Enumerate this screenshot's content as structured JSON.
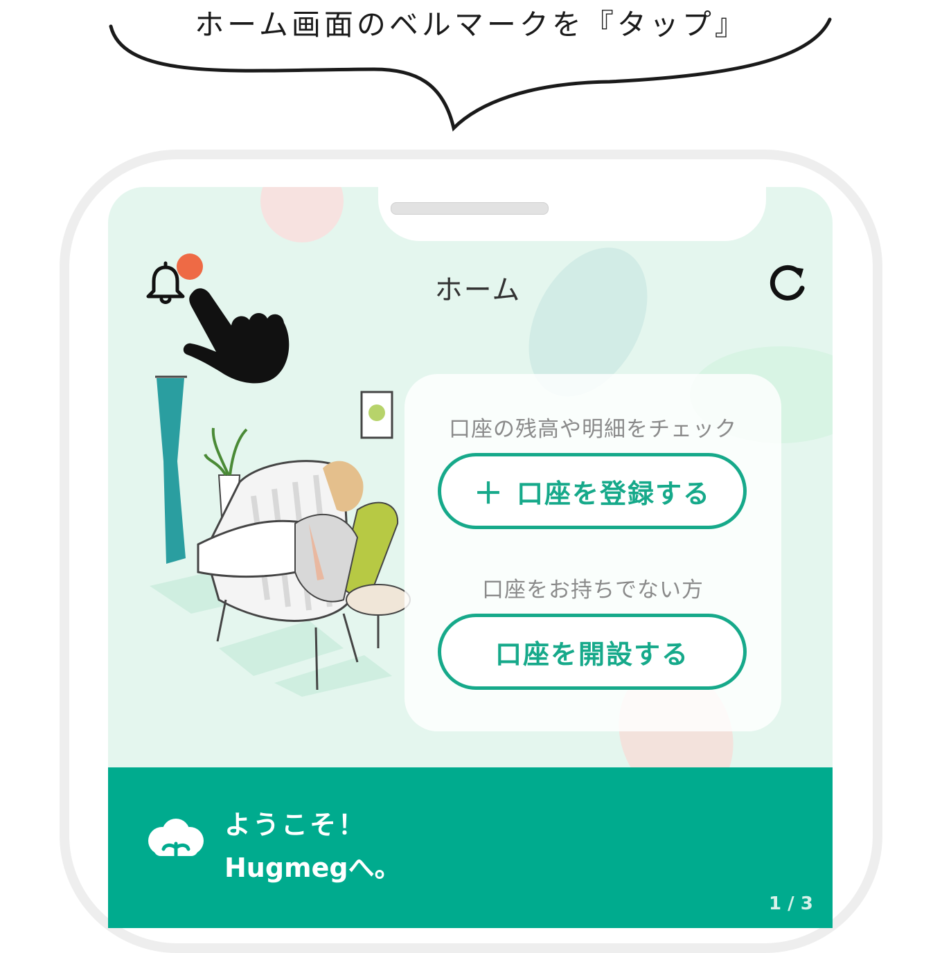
{
  "instruction": {
    "text": "ホーム画面のベルマークを『タップ』"
  },
  "header": {
    "title": "ホーム",
    "bell_icon": "bell-icon",
    "refresh_icon": "refresh-icon",
    "has_notification": true
  },
  "account_card": {
    "check_label": "口座の残高や明細をチェック",
    "register_button": "口座を登録する",
    "register_icon": "plus-icon",
    "no_account_label": "口座をお持ちでない方",
    "open_button": "口座を開設する"
  },
  "welcome_banner": {
    "line1": "ようこそ！",
    "line2": "Hugmegへ。",
    "page_indicator": "1 / 3"
  },
  "colors": {
    "brand_green": "#00ab8e",
    "button_green": "#16a98a",
    "screen_bg": "#e4f6ee",
    "notification_dot": "#ee6a45"
  }
}
